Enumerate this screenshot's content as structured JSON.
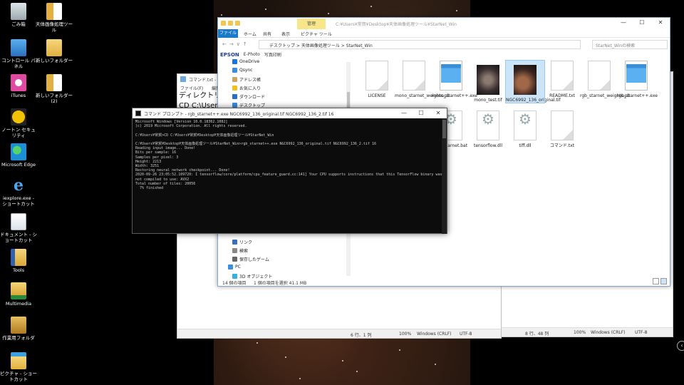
{
  "desktop": {
    "icons": [
      {
        "label": "ごみ箱",
        "icon": "recycle-bin-icon"
      },
      {
        "label": "コントロール パネル",
        "icon": "control-panel-icon"
      },
      {
        "label": "iTunes",
        "icon": "itunes-icon"
      },
      {
        "label": "ノートン セキュリティ",
        "icon": "norton-icon"
      },
      {
        "label": "Microsoft Edge",
        "icon": "edge-icon"
      },
      {
        "label": "iexplore.exe - ショートカット",
        "icon": "ie-icon"
      },
      {
        "label": "ドキュメント - ショートカット",
        "icon": "documents-shortcut-icon"
      },
      {
        "label": "Tools",
        "icon": "tools-folder-icon"
      },
      {
        "label": "Multimedia",
        "icon": "multimedia-folder-icon"
      },
      {
        "label": "作業用フォルダ",
        "icon": "work-folder-icon"
      },
      {
        "label": "ピクチャ - ショートカット",
        "icon": "pictures-shortcut-icon"
      },
      {
        "label": "天体画像処理ツール",
        "icon": "folder-icon"
      },
      {
        "label": "新しいフォルダー",
        "icon": "folder-icon"
      },
      {
        "label": "新しいフォルダー (2)",
        "icon": "folder-icon"
      }
    ]
  },
  "notepad_back": {
    "status_pos": "8 行、48 列",
    "status_zoom": "100%",
    "status_eol": "Windows (CRLF)",
    "status_enc": "UTF-8"
  },
  "notepad_mid": {
    "title": "コマンド.txt - メモ帳",
    "menu": [
      "ファイル(F)",
      "編集(E)"
    ],
    "line1": "ディレクトリ移",
    "line2": "CD C:\\Users¥",
    "status_pos": "6 行、1 列",
    "status_zoom": "100%",
    "status_eol": "Windows (CRLF)",
    "status_enc": "UTF-8"
  },
  "explorer": {
    "title_path": "C:¥Users¥常賀¥Desktop¥天体画像処理ツール¥StarNet_Win",
    "manage_tab": "管理",
    "ribbon_tabs": [
      "ファイル",
      "ホーム",
      "共有",
      "表示",
      "ピクチャ ツール"
    ],
    "address": [
      "デスクトップ",
      "天体画像処理ツール",
      "StarNet_Win"
    ],
    "search_placeholder": "StarNet_Winの検索",
    "epson_brand": "EPSON",
    "epson_items": [
      "E-Photo",
      "写真印刷"
    ],
    "nav_items_top": [
      "OneDrive",
      "Qsync",
      "アドレス帳",
      "お気に入り",
      "ダウンロード",
      "デスクトップ"
    ],
    "nav_items_bottom": [
      "リンク",
      "検索",
      "保存したゲーム",
      "PC",
      "3D オブジェクト"
    ],
    "files": [
      {
        "name": "LICENSE",
        "type": "doc"
      },
      {
        "name": "mono_starnet_weights.pb",
        "type": "doc"
      },
      {
        "name": "mono_starnet++.exe",
        "type": "exe"
      },
      {
        "name": "mono_test.tif",
        "type": "img"
      },
      {
        "name": "NGC6992_136_original.tif",
        "type": "img2",
        "selected": true
      },
      {
        "name": "README.txt",
        "type": "doc"
      },
      {
        "name": "rgb_starnet_weights.pb",
        "type": "doc"
      },
      {
        "name": "rgb_starnet++.exe",
        "type": "exe"
      },
      {
        "name": "rgb_starnet.bat",
        "type": "gear"
      },
      {
        "name": "tensorflow.dll",
        "type": "gear"
      },
      {
        "name": "tiff.dll",
        "type": "gear"
      },
      {
        "name": "コマンド.txt",
        "type": "doc"
      }
    ],
    "status_count": "14 個の項目",
    "status_selection": "1 個の項目を選択 41.1 MB"
  },
  "cmd": {
    "title": "コマンド プロンプト - rgb_starnet++.exe  NGC6992_136_original.tif NGC6992_136_2.tif 16",
    "lines": [
      "Microsoft Windows [Version 10.0.18362.1082]",
      "(c) 2019 Microsoft Corporation. All rights reserved.",
      "",
      "C:¥Users¥常賀>CD C:¥Users¥常賀¥Desktop¥天体画像処理ツール¥StarNet_Win",
      "",
      "C:¥Users¥常賀¥Desktop¥天体画像処理ツール¥StarNet_Win>rgb_starnet++.exe NGC6992_136_original.tif NGC6992_136_2.tif 16",
      "Reading input image... Done!",
      "Bits per sample: 16",
      "Samples per pixel: 3",
      "Height: 2213",
      "Width: 3251",
      "Restoring neural network checkpoint... Done!",
      "2020-09-26 23:05:52.109720: I tensorflow/core/platform/cpu_feature_guard.cc:141] Your CPU supports instructions that this TensorFlow binary was",
      "not compiled to use: AVX2",
      "Total number of tiles: 20056",
      "  7% finished"
    ]
  }
}
